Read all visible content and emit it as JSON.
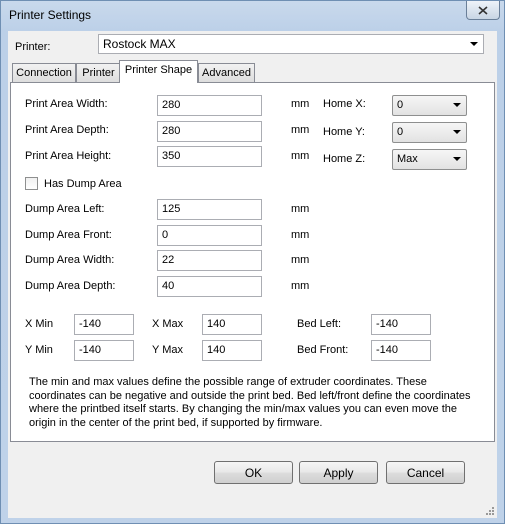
{
  "window": {
    "title": "Printer Settings"
  },
  "printer": {
    "label": "Printer:",
    "value": "Rostock MAX"
  },
  "tabs": [
    "Connection",
    "Printer",
    "Printer Shape",
    "Advanced"
  ],
  "shape": {
    "print_area_width": {
      "label": "Print Area Width:",
      "value": "280",
      "unit": "mm"
    },
    "print_area_depth": {
      "label": "Print Area Depth:",
      "value": "280",
      "unit": "mm"
    },
    "print_area_height": {
      "label": "Print Area Height:",
      "value": "350",
      "unit": "mm"
    },
    "home_x": {
      "label": "Home X:",
      "value": "0"
    },
    "home_y": {
      "label": "Home Y:",
      "value": "0"
    },
    "home_z": {
      "label": "Home Z:",
      "value": "Max"
    },
    "has_dump_area": {
      "label": "Has Dump Area",
      "checked": false
    },
    "dump_left": {
      "label": "Dump Area Left:",
      "value": "125",
      "unit": "mm"
    },
    "dump_front": {
      "label": "Dump Area Front:",
      "value": "0",
      "unit": "mm"
    },
    "dump_width": {
      "label": "Dump Area Width:",
      "value": "22",
      "unit": "mm"
    },
    "dump_depth": {
      "label": "Dump Area Depth:",
      "value": "40",
      "unit": "mm"
    },
    "x_min": {
      "label": "X Min",
      "value": "-140"
    },
    "x_max": {
      "label": "X Max",
      "value": "140"
    },
    "bed_left": {
      "label": "Bed Left:",
      "value": "-140"
    },
    "y_min": {
      "label": "Y Min",
      "value": "-140"
    },
    "y_max": {
      "label": "Y Max",
      "value": "140"
    },
    "bed_front": {
      "label": "Bed Front:",
      "value": "-140"
    },
    "description": "The min and max values define the possible range of extruder coordinates. These coordinates can be negative and outside the print bed. Bed left/front define the coordinates where the printbed itself starts. By changing the min/max values you can even move the origin in the center of the print bed, if supported by firmware."
  },
  "buttons": {
    "ok": "OK",
    "apply": "Apply",
    "cancel": "Cancel"
  }
}
